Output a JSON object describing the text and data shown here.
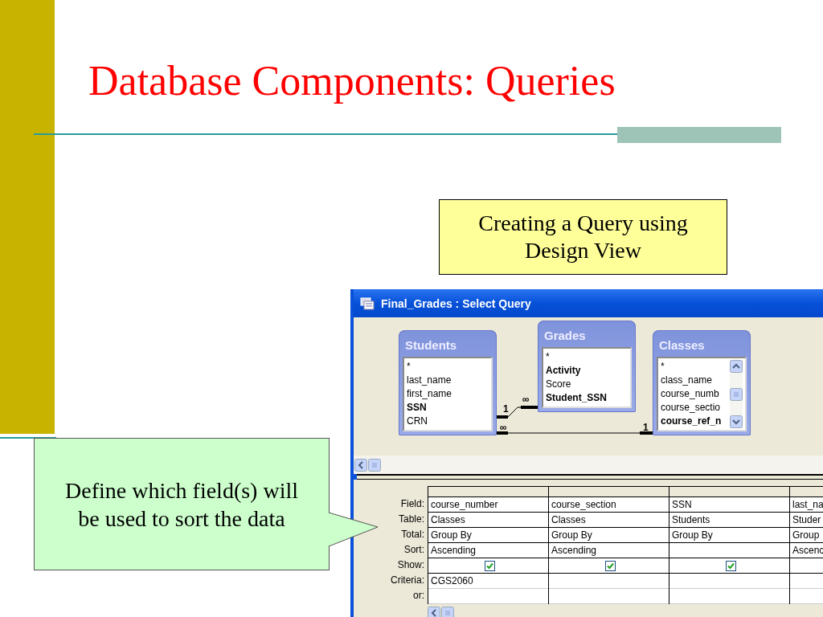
{
  "slide": {
    "title": "Database Components: Queries"
  },
  "note": {
    "text": "Creating a Query using Design View"
  },
  "callout": {
    "text": "Define which field(s) will  be used to sort the data"
  },
  "window": {
    "title": "Final_Grades : Select Query"
  },
  "tables": [
    {
      "name": "Students",
      "scrollbar": false,
      "fields": [
        {
          "name": "*",
          "key": false
        },
        {
          "name": "last_name",
          "key": false
        },
        {
          "name": "first_name",
          "key": false
        },
        {
          "name": "SSN",
          "key": true
        },
        {
          "name": "CRN",
          "key": false
        }
      ]
    },
    {
      "name": "Grades",
      "scrollbar": false,
      "fields": [
        {
          "name": "*",
          "key": false
        },
        {
          "name": "Activity",
          "key": true
        },
        {
          "name": "Score",
          "key": false
        },
        {
          "name": "Student_SSN",
          "key": true
        }
      ]
    },
    {
      "name": "Classes",
      "scrollbar": true,
      "fields": [
        {
          "name": "*",
          "key": false
        },
        {
          "name": "class_name",
          "key": false
        },
        {
          "name": "course_numb",
          "key": false
        },
        {
          "name": "course_sectio",
          "key": false
        },
        {
          "name": "course_ref_n",
          "key": true
        }
      ]
    }
  ],
  "relationships": [
    {
      "from_label": "1",
      "to_label": "∞"
    },
    {
      "from_label": "∞",
      "to_label": "1"
    }
  ],
  "grid": {
    "row_labels": [
      "Field:",
      "Table:",
      "Total:",
      "Sort:",
      "Show:",
      "Criteria:",
      "or:"
    ],
    "columns": [
      {
        "field": "course_number",
        "table": "Classes",
        "total": "Group By",
        "sort": "Ascending",
        "show": true,
        "criteria": "CGS2060"
      },
      {
        "field": "course_section",
        "table": "Classes",
        "total": "Group By",
        "sort": "Ascending",
        "show": true
      },
      {
        "field": "SSN",
        "table": "Students",
        "total": "Group By",
        "show": true
      },
      {
        "field": "last_na",
        "table": "Studer",
        "total": "Group",
        "sort": "Ascenc",
        "show": false
      }
    ]
  }
}
